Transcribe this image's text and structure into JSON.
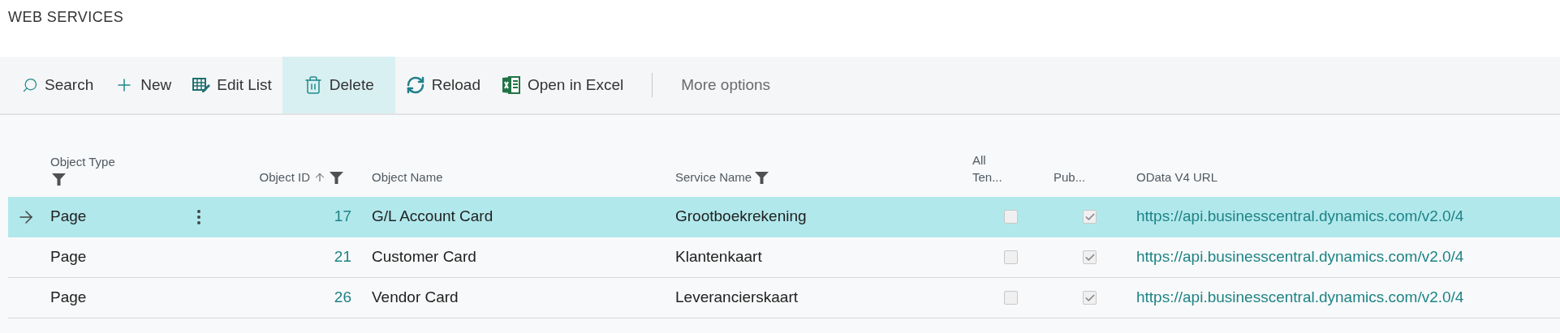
{
  "page_title": "WEB SERVICES",
  "actions": [
    {
      "kind": "search",
      "label": "Search",
      "highlighted": false
    },
    {
      "kind": "new",
      "label": "New",
      "highlighted": false
    },
    {
      "kind": "edit",
      "label": "Edit List",
      "highlighted": false
    },
    {
      "kind": "delete",
      "label": "Delete",
      "highlighted": true
    },
    {
      "kind": "reload",
      "label": "Reload",
      "highlighted": false
    },
    {
      "kind": "excel",
      "label": "Open in Excel",
      "highlighted": false
    },
    {
      "kind": "more",
      "label": "More options",
      "highlighted": false
    }
  ],
  "table": {
    "columns": [
      {
        "label": "Object Type",
        "filter": true,
        "sorted_ascending": false
      },
      {
        "label": "Object ID",
        "filter": true,
        "sorted_ascending": true
      },
      {
        "label": "Object Name",
        "filter": false,
        "sorted_ascending": false
      },
      {
        "label": "Service Name",
        "filter": true,
        "sorted_ascending": false
      },
      {
        "label": "All Ten...",
        "filter": false,
        "sorted_ascending": false
      },
      {
        "label": "Pub...",
        "filter": false,
        "sorted_ascending": false
      },
      {
        "label": "OData V4 URL",
        "filter": false,
        "sorted_ascending": false
      }
    ],
    "rows": [
      {
        "selected": true,
        "object_type": "Page",
        "object_id": "17",
        "object_name": "G/L Account Card",
        "service_name": "Grootboekrekening",
        "all_tenants": false,
        "published": true,
        "url": "https://api.businesscentral.dynamics.com/v2.0/4"
      },
      {
        "selected": false,
        "object_type": "Page",
        "object_id": "21",
        "object_name": "Customer Card",
        "service_name": "Klantenkaart",
        "all_tenants": false,
        "published": true,
        "url": "https://api.businesscentral.dynamics.com/v2.0/4"
      },
      {
        "selected": false,
        "object_type": "Page",
        "object_id": "26",
        "object_name": "Vendor Card",
        "service_name": "Leverancierskaart",
        "all_tenants": false,
        "published": true,
        "url": "https://api.businesscentral.dynamics.com/v2.0/4"
      }
    ]
  }
}
